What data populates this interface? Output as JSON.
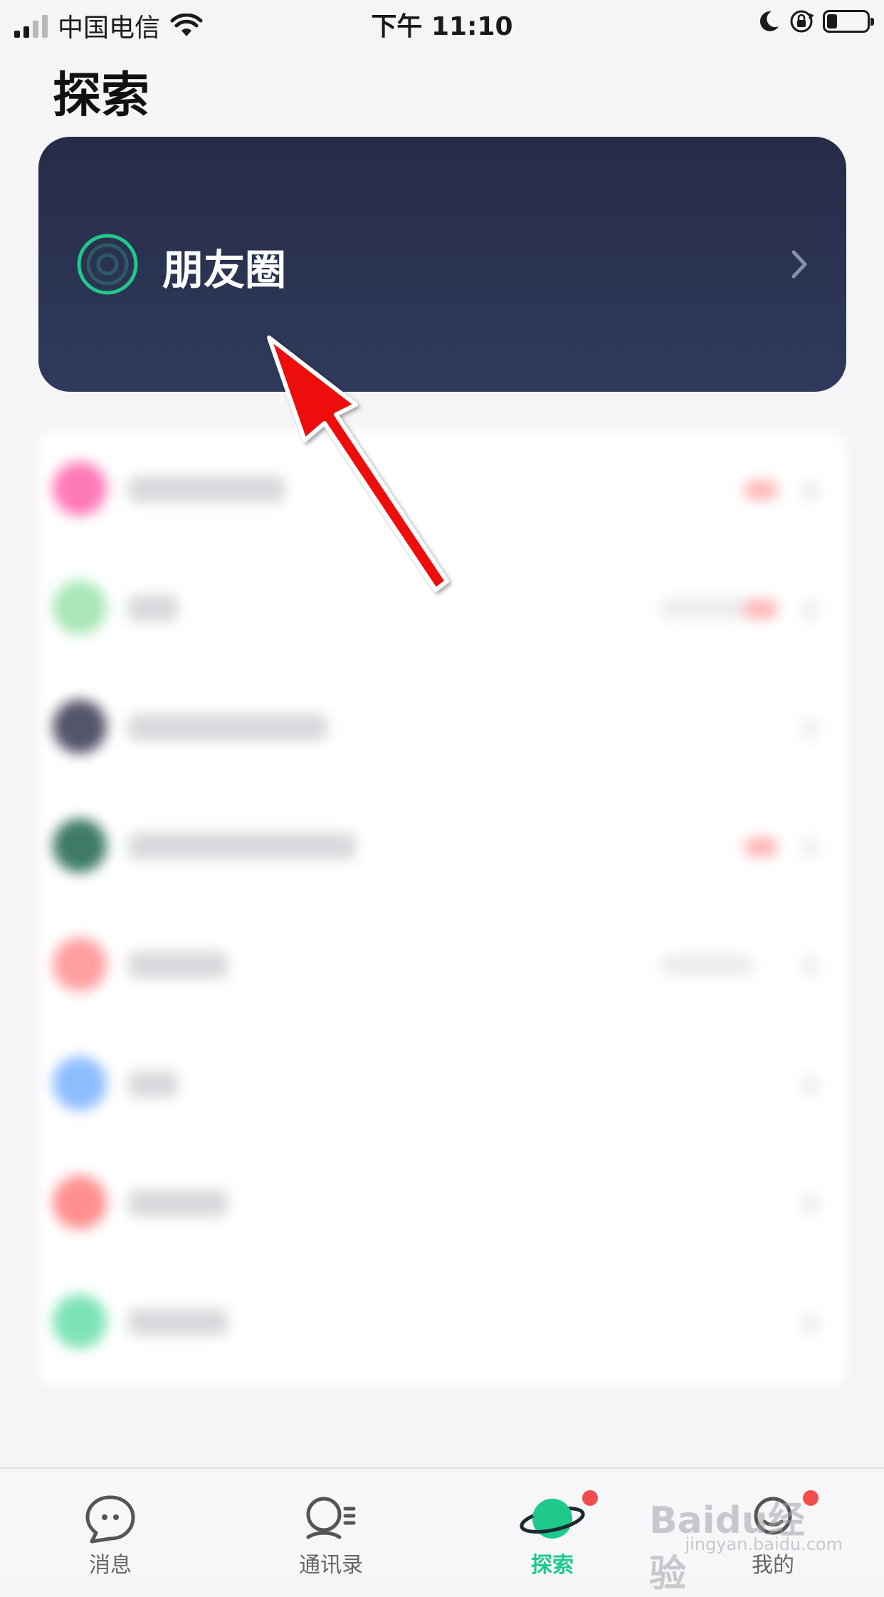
{
  "status_bar": {
    "carrier": "中国电信",
    "time": "下午 11:10",
    "battery_level": 0.25
  },
  "page": {
    "title": "探索"
  },
  "moments": {
    "label": "朋友圈",
    "accent_color": "#1fc98b",
    "card_color": "#2a3150"
  },
  "list_items": [
    {
      "avatar_color": "#ff79b8",
      "badge": true
    },
    {
      "avatar_color": "#a9e6b8",
      "badge": true,
      "meta": true
    },
    {
      "avatar_color": "#54546a"
    },
    {
      "avatar_color": "#3f7a68",
      "badge": true
    },
    {
      "avatar_color": "#ff9f9f",
      "meta": true
    },
    {
      "avatar_color": "#8dbdff"
    },
    {
      "avatar_color": "#ff8f8f"
    },
    {
      "avatar_color": "#7de3b5"
    }
  ],
  "tabs": [
    {
      "label": "消息",
      "icon": "chat-bubble-icon",
      "active": false,
      "dot": false
    },
    {
      "label": "通讯录",
      "icon": "contacts-icon",
      "active": false,
      "dot": false
    },
    {
      "label": "探索",
      "icon": "planet-icon",
      "active": true,
      "dot": true
    },
    {
      "label": "我的",
      "icon": "profile-icon",
      "active": false,
      "dot": true
    }
  ],
  "watermark": {
    "brand": "Baidu经验",
    "url": "jingyan.baidu.com"
  },
  "colors": {
    "active_tab": "#1fc98b",
    "notification_dot": "#f24d4d",
    "arrow": "#ee1111"
  }
}
